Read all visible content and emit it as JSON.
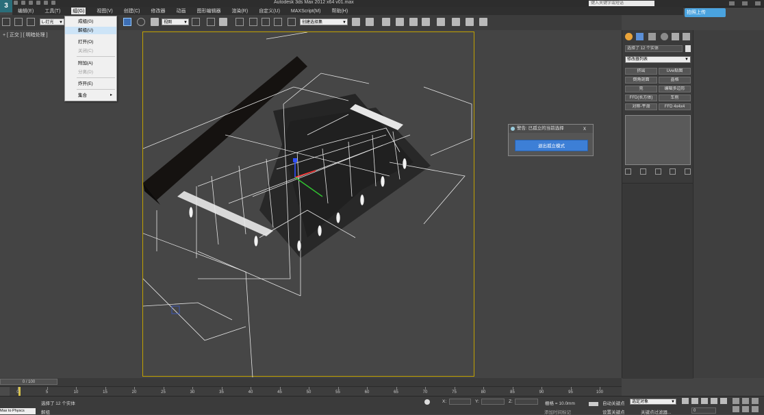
{
  "window": {
    "title": "Autodesk 3ds Max  2012 x64      v01.max",
    "search_placeholder": "键入关键字或短语",
    "upload_label": "拍照上传"
  },
  "menubar": {
    "items": [
      {
        "label": "编辑(E)"
      },
      {
        "label": "工具(T)"
      },
      {
        "label": "组(G)"
      },
      {
        "label": "视图(V)"
      },
      {
        "label": "创建(C)"
      },
      {
        "label": "修改器"
      },
      {
        "label": "动画"
      },
      {
        "label": "图形编辑器"
      },
      {
        "label": "渲染(R)"
      },
      {
        "label": "自定义(U)"
      },
      {
        "label": "MAXScript(M)"
      },
      {
        "label": "帮助(H)"
      }
    ]
  },
  "toolbar": {
    "selection_filter": "L-灯光",
    "reference_coord": "视图",
    "named_selection": "创建选择集"
  },
  "viewport": {
    "label": "+ [ 正交 ] [ 明暗处理 ]"
  },
  "group_menu": {
    "items": [
      {
        "label": "成组(G)",
        "enabled": true
      },
      {
        "label": "解组(U)",
        "enabled": true,
        "highlighted": true
      },
      {
        "label": "打开(O)",
        "enabled": true
      },
      {
        "label": "关闭(C)",
        "enabled": false
      },
      {
        "label": "附加(A)",
        "enabled": true
      },
      {
        "label": "分离(D)",
        "enabled": false
      },
      {
        "label": "炸开(E)",
        "enabled": true
      },
      {
        "label": "集合",
        "enabled": true,
        "submenu": true
      }
    ]
  },
  "dialog": {
    "title": "警告: 已孤立的当前选择",
    "close_symbol": "x",
    "button_label": "退出孤立模式"
  },
  "command_panel": {
    "selection_count": "选择了 12 个实体",
    "modifier_list": "修改器列表",
    "buttons": [
      "挤出",
      "Uvw贴图",
      "倒角剖面",
      "晶格",
      "壳",
      "编辑多边形",
      "FFD(长方体)",
      "车削",
      "对称-平滑",
      "FFD 4x4x4"
    ]
  },
  "timeline": {
    "slider_label": "0 / 100",
    "ticks": [
      "0",
      "5",
      "10",
      "15",
      "20",
      "25",
      "30",
      "35",
      "40",
      "45",
      "50",
      "55",
      "60",
      "65",
      "70",
      "75",
      "80",
      "85",
      "90",
      "95",
      "100"
    ]
  },
  "status": {
    "maxscript_label": "Max to Physcs",
    "prompt": "选择了 12 个实体",
    "hint": "解组",
    "x_label": "X:",
    "y_label": "Y:",
    "z_label": "Z:",
    "grid_label": "栅格 = 10.0mm",
    "autokey_label": "自动关键点",
    "setkey_label": "设置关键点",
    "selected_obj": "选定对象",
    "keyfilter_label": "关键点过滤器...",
    "add_timetag": "添加时间标记",
    "frame_value": "0"
  }
}
